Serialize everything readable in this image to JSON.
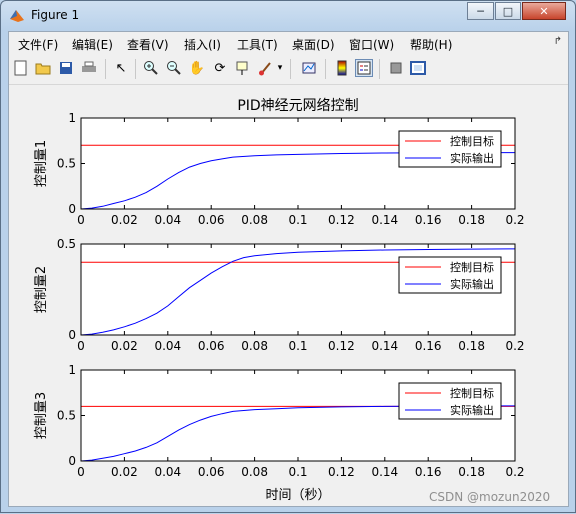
{
  "window": {
    "title": "Figure 1"
  },
  "menu": [
    "文件(F)",
    "编辑(E)",
    "查看(V)",
    "插入(I)",
    "工具(T)",
    "桌面(D)",
    "窗口(W)",
    "帮助(H)"
  ],
  "toolbar_icons": [
    "new-figure-icon",
    "open-file-icon",
    "save-icon",
    "print-icon",
    "pointer-icon",
    "zoom-in-icon",
    "zoom-out-icon",
    "pan-hand-icon",
    "rotate-3d-icon",
    "data-cursor-icon",
    "brush-icon",
    "link-plot-icon",
    "colorbar-icon",
    "legend-icon",
    "hide-plot-tools-icon",
    "show-plot-tools-icon"
  ],
  "colors": {
    "target": "#ff0000",
    "actual": "#0000ff"
  },
  "figure": {
    "title": "PID神经元网络控制",
    "xlabel": "时间（秒）",
    "watermark": "CSDN @mozun2020"
  },
  "chart_data": [
    {
      "type": "line",
      "title": "PID神经元网络控制",
      "ylabel": "控制量1",
      "xlim": [
        0,
        0.2
      ],
      "ylim": [
        0,
        1
      ],
      "xticks": [
        "0",
        "0.02",
        "0.04",
        "0.06",
        "0.08",
        "0.1",
        "0.12",
        "0.14",
        "0.16",
        "0.18",
        "0.2"
      ],
      "yticks": [
        "0",
        "0.5",
        "1"
      ],
      "legend": "top-right",
      "series": [
        {
          "name": "控制目标",
          "color": "#ff0000",
          "x": [
            0,
            0.2
          ],
          "y": [
            0.7,
            0.7
          ]
        },
        {
          "name": "实际输出",
          "color": "#0000ff",
          "x": [
            0,
            0.005,
            0.01,
            0.015,
            0.02,
            0.025,
            0.03,
            0.035,
            0.04,
            0.045,
            0.05,
            0.055,
            0.06,
            0.065,
            0.07,
            0.08,
            0.09,
            0.1,
            0.12,
            0.14,
            0.16,
            0.18,
            0.2
          ],
          "y": [
            0,
            0.01,
            0.03,
            0.06,
            0.09,
            0.13,
            0.18,
            0.25,
            0.33,
            0.4,
            0.46,
            0.5,
            0.53,
            0.55,
            0.57,
            0.585,
            0.595,
            0.6,
            0.61,
            0.615,
            0.618,
            0.62,
            0.62
          ]
        }
      ]
    },
    {
      "type": "line",
      "ylabel": "控制量2",
      "xlim": [
        0,
        0.2
      ],
      "ylim": [
        0,
        0.5
      ],
      "xticks": [
        "0",
        "0.02",
        "0.04",
        "0.06",
        "0.08",
        "0.1",
        "0.12",
        "0.14",
        "0.16",
        "0.18",
        "0.2"
      ],
      "yticks": [
        "0",
        "0.5"
      ],
      "legend": "top-right",
      "series": [
        {
          "name": "控制目标",
          "color": "#ff0000",
          "x": [
            0,
            0.2
          ],
          "y": [
            0.4,
            0.4
          ]
        },
        {
          "name": "实际输出",
          "color": "#0000ff",
          "x": [
            0,
            0.005,
            0.01,
            0.015,
            0.02,
            0.025,
            0.03,
            0.035,
            0.04,
            0.045,
            0.05,
            0.055,
            0.06,
            0.065,
            0.07,
            0.075,
            0.08,
            0.09,
            0.1,
            0.12,
            0.14,
            0.16,
            0.18,
            0.2
          ],
          "y": [
            0,
            0.005,
            0.015,
            0.028,
            0.045,
            0.065,
            0.09,
            0.12,
            0.16,
            0.21,
            0.26,
            0.3,
            0.34,
            0.375,
            0.405,
            0.425,
            0.435,
            0.447,
            0.455,
            0.462,
            0.467,
            0.47,
            0.472,
            0.473
          ]
        }
      ]
    },
    {
      "type": "line",
      "ylabel": "控制量3",
      "xlabel": "时间（秒）",
      "xlim": [
        0,
        0.2
      ],
      "ylim": [
        0,
        1
      ],
      "xticks": [
        "0",
        "0.02",
        "0.04",
        "0.06",
        "0.08",
        "0.1",
        "0.12",
        "0.14",
        "0.16",
        "0.18",
        "0.2"
      ],
      "yticks": [
        "0",
        "0.5",
        "1"
      ],
      "legend": "top-right",
      "series": [
        {
          "name": "控制目标",
          "color": "#ff0000",
          "x": [
            0,
            0.2
          ],
          "y": [
            0.6,
            0.6
          ]
        },
        {
          "name": "实际输出",
          "color": "#0000ff",
          "x": [
            0,
            0.005,
            0.01,
            0.015,
            0.02,
            0.025,
            0.03,
            0.035,
            0.04,
            0.045,
            0.05,
            0.055,
            0.06,
            0.065,
            0.07,
            0.08,
            0.09,
            0.1,
            0.12,
            0.14,
            0.16,
            0.18,
            0.2
          ],
          "y": [
            0,
            0.01,
            0.03,
            0.05,
            0.08,
            0.11,
            0.15,
            0.2,
            0.27,
            0.34,
            0.4,
            0.45,
            0.49,
            0.52,
            0.545,
            0.565,
            0.575,
            0.585,
            0.595,
            0.6,
            0.603,
            0.605,
            0.606
          ]
        }
      ]
    }
  ]
}
